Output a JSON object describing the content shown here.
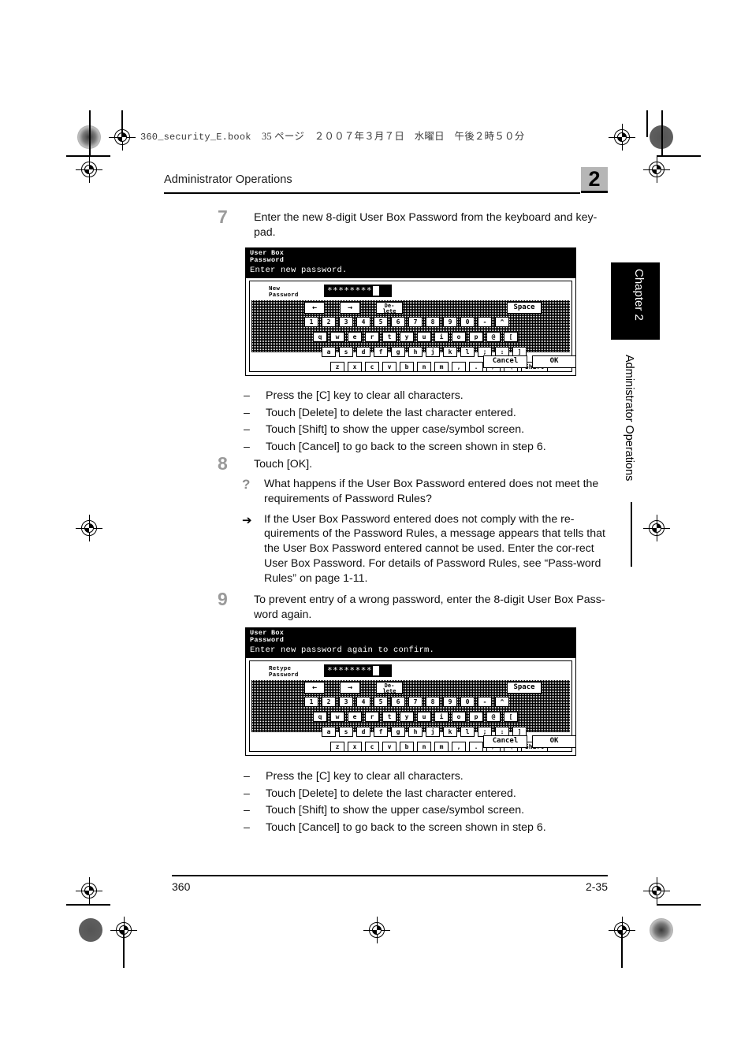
{
  "header": {
    "file_line": "360_security_E.book",
    "page_line": "35 ページ　２００７年３月７日　水曜日　午後２時５０分",
    "running_title": "Administrator Operations",
    "chapter_number": "2"
  },
  "side": {
    "chapter_tab": "Chapter 2",
    "vertical_label": "Administrator Operations"
  },
  "steps": [
    {
      "number": "7",
      "text": "Enter the new 8-digit User Box Password from the keyboard and key-pad."
    },
    {
      "number": "8",
      "text": "Touch [OK]."
    },
    {
      "number": "9",
      "text": "To prevent entry of a wrong password, enter the 8-digit User Box Pass-word again."
    }
  ],
  "notes_after_step7": [
    "Press the [C] key to clear all characters.",
    "Touch [Delete] to delete the last character entered.",
    "Touch [Shift] to show the upper case/symbol screen.",
    "Touch [Cancel] to go back to the screen shown in step 6."
  ],
  "notes_after_step9": [
    "Press the [C] key to clear all characters.",
    "Touch [Delete] to delete the last character entered.",
    "Touch [Shift] to show the upper case/symbol screen.",
    "Touch [Cancel] to go back to the screen shown in step 6."
  ],
  "qa": {
    "question_mark": "?",
    "arrow_mark": "➔",
    "question": "What happens if the User Box Password entered does not meet the requirements of Password Rules?",
    "answer": "If the User Box Password entered does not comply with the re-quirements of the Password Rules, a message appears that tells that the User Box Password entered cannot be used. Enter the cor-rect User Box Password. For details of Password Rules, see “Pass-word Rules” on page 1-11."
  },
  "lcd_panel_1": {
    "title_line1": "User Box",
    "title_line2": "Password",
    "instruction": "Enter new password.",
    "field_label_line1": "New",
    "field_label_line2": "Password",
    "field_value": "********",
    "edit_keys": {
      "left": "←",
      "right": "→",
      "delete_line1": "De-",
      "delete_line2": "lete",
      "space": "Space"
    },
    "row_numbers": [
      "1",
      "2",
      "3",
      "4",
      "5",
      "6",
      "7",
      "8",
      "9",
      "0",
      "-",
      "^"
    ],
    "row_q": [
      "q",
      "w",
      "e",
      "r",
      "t",
      "y",
      "u",
      "i",
      "o",
      "p",
      "@",
      "["
    ],
    "row_a": [
      "a",
      "s",
      "d",
      "f",
      "g",
      "h",
      "j",
      "k",
      "l",
      ";",
      ":",
      "]"
    ],
    "row_z": [
      "z",
      "x",
      "c",
      "v",
      "b",
      "n",
      "m",
      ",",
      ".",
      "/",
      "\\"
    ],
    "shift": "Shift",
    "cancel": "Cancel",
    "ok": "OK"
  },
  "lcd_panel_2": {
    "title_line1": "User Box",
    "title_line2": "Password",
    "instruction": "Enter new password again to confirm.",
    "field_label_line1": "Retype",
    "field_label_line2": "Password",
    "field_value": "********",
    "edit_keys": {
      "left": "←",
      "right": "→",
      "delete_line1": "De-",
      "delete_line2": "lete",
      "space": "Space"
    },
    "row_numbers": [
      "1",
      "2",
      "3",
      "4",
      "5",
      "6",
      "7",
      "8",
      "9",
      "0",
      "-",
      "^"
    ],
    "row_q": [
      "q",
      "w",
      "e",
      "r",
      "t",
      "y",
      "u",
      "i",
      "o",
      "p",
      "@",
      "["
    ],
    "row_a": [
      "a",
      "s",
      "d",
      "f",
      "g",
      "h",
      "j",
      "k",
      "l",
      ";",
      ":",
      "]"
    ],
    "row_z": [
      "z",
      "x",
      "c",
      "v",
      "b",
      "n",
      "m",
      ",",
      ".",
      "/",
      "\\"
    ],
    "shift": "Shift",
    "cancel": "Cancel",
    "ok": "OK"
  },
  "footer": {
    "left": "360",
    "right": "2-35"
  },
  "dash": "–"
}
